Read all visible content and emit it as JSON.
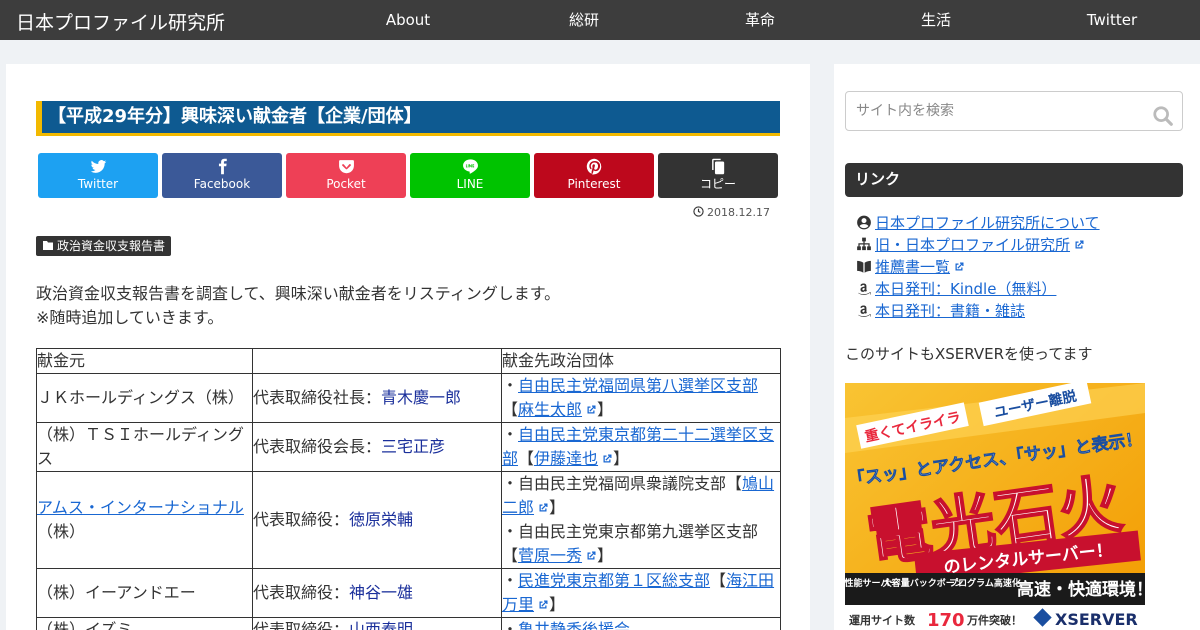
{
  "site": {
    "title": "日本プロファイル研究所"
  },
  "nav": {
    "items": [
      "About",
      "総研",
      "革命",
      "生活",
      "Twitter"
    ]
  },
  "article": {
    "title": "【平成29年分】興味深い献金者【企業/団体】",
    "share": [
      "Twitter",
      "Facebook",
      "Pocket",
      "LINE",
      "Pinterest",
      "コピー"
    ],
    "date": "2018.12.17",
    "category": "政治資金収支報告書",
    "intro": [
      "政治資金収支報告書を調査して、興味深い献金者をリスティングします。",
      "※随時追加していきます。"
    ],
    "table": {
      "headers": [
        "献金元",
        "",
        "献金先政治団体"
      ],
      "rows": [
        {
          "donor": "ＪＫホールディングス（株）",
          "donor_link": "",
          "donor_suffix": "",
          "role": "代表取締役社長：",
          "person": "青木慶一郎",
          "recipients": [
            {
              "bullet": "・",
              "link": "自由民主党福岡県第八選挙区支部",
              "plain": "",
              "open": "【",
              "name": "麻生太郎",
              "close": "】"
            }
          ]
        },
        {
          "donor": "（株）ＴＳＩホールディングス",
          "donor_link": "",
          "donor_suffix": "",
          "role": "代表取締役会長：",
          "person": "三宅正彦",
          "recipients": [
            {
              "bullet": "・",
              "link": "自由民主党東京都第二十二選挙区支部",
              "plain": "",
              "open": "【",
              "name": "伊藤達也",
              "close": "】"
            }
          ]
        },
        {
          "donor": "",
          "donor_link": "アムス・インターナショナル",
          "donor_suffix": "（株）",
          "role": "代表取締役：",
          "person": "徳原栄輔",
          "recipients": [
            {
              "bullet": "・",
              "link": "",
              "plain": "自由民主党福岡県衆議院支部",
              "open": "【",
              "name": "鳩山二郎",
              "close": "】"
            },
            {
              "bullet": "・",
              "link": "",
              "plain": "自由民主党東京都第九選挙区支部",
              "open": "【",
              "name": "菅原一秀",
              "close": "】"
            }
          ]
        },
        {
          "donor": "（株）イーアンドエー",
          "donor_link": "",
          "donor_suffix": "",
          "role": "代表取締役：",
          "person": "神谷一雄",
          "recipients": [
            {
              "bullet": "・",
              "link": "民進党東京都第１区総支部",
              "plain": "",
              "open": "【",
              "name": "海江田万里",
              "close": "】"
            }
          ]
        },
        {
          "donor": "（株）イズミ",
          "donor_link": "",
          "donor_suffix": "",
          "role": "代表取締役：",
          "person": "山西泰明",
          "recipients": [
            {
              "bullet": "・",
              "link": "亀井静香後援会",
              "plain": "",
              "open": "",
              "name": "",
              "close": ""
            }
          ]
        }
      ]
    }
  },
  "sidebar": {
    "search_placeholder": "サイト内を検索",
    "widget_title": "リンク",
    "links": [
      {
        "icon": "user-circle-icon",
        "label": "日本プロファイル研究所について",
        "external": false
      },
      {
        "icon": "sitemap-icon",
        "label": "旧・日本プロファイル研究所",
        "external": true
      },
      {
        "icon": "book-open-icon",
        "label": "推薦書一覧",
        "external": true
      },
      {
        "icon": "amazon-icon",
        "label": "本日発刊：Kindle（無料）",
        "external": false
      },
      {
        "icon": "amazon-icon",
        "label": "本日発刊：書籍・雑誌",
        "external": false
      }
    ],
    "xserver_note": "このサイトもXSERVERを使ってます",
    "banner": {
      "tag1": "重くてイライラ",
      "tag2": "ユーザー離脱",
      "catch": "「スッ」とアクセス、「サッ」と表示！",
      "headline": "電光石火",
      "sub": "のレンタルサーバー！",
      "features": [
        "高性能サーバー",
        "大容量バックボーン",
        "プログラム高速化"
      ],
      "feature_claim": "高速・快適環境！",
      "stats_prefix": "運用サイト数",
      "stats_num": "170",
      "stats_suffix": "万件突破！",
      "brand": "XSERVER"
    }
  }
}
